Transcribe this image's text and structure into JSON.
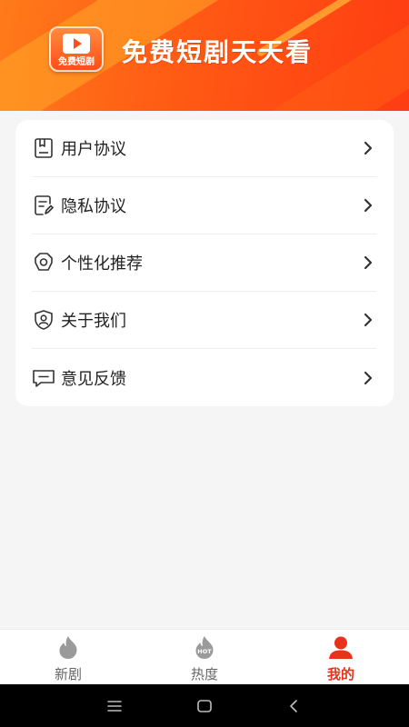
{
  "header": {
    "logo_text": "免费短剧",
    "title": "免费短剧天天看"
  },
  "menu": {
    "items": [
      {
        "label": "用户协议",
        "icon": "book-icon"
      },
      {
        "label": "隐私协议",
        "icon": "document-edit-icon"
      },
      {
        "label": "个性化推荐",
        "icon": "gear-icon"
      },
      {
        "label": "关于我们",
        "icon": "shield-user-icon"
      },
      {
        "label": "意见反馈",
        "icon": "message-icon"
      }
    ]
  },
  "tabbar": {
    "tabs": [
      {
        "label": "新剧",
        "icon": "flame-icon",
        "active": false
      },
      {
        "label": "热度",
        "icon": "hot-flame-icon",
        "badge": "HOT",
        "active": false
      },
      {
        "label": "我的",
        "icon": "user-icon",
        "active": true
      }
    ]
  },
  "system_nav": {
    "buttons": [
      "menu-icon",
      "home-icon",
      "back-icon"
    ]
  },
  "colors": {
    "accent": "#e8321c",
    "header_start": "#ff7a1a",
    "header_end": "#ff3c12"
  }
}
